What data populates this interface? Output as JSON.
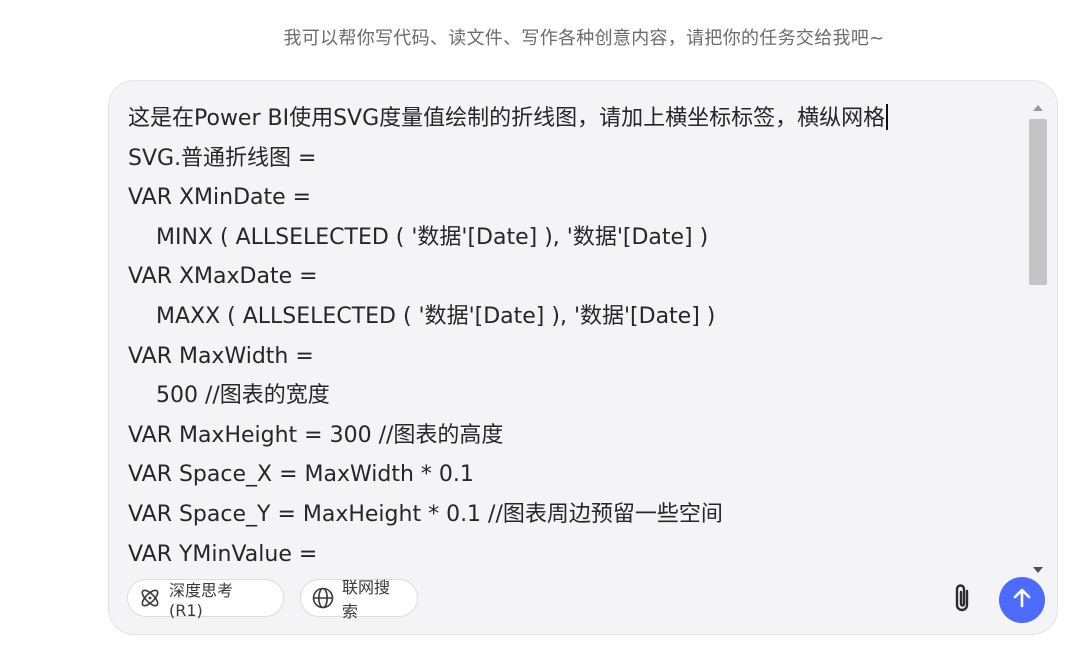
{
  "hint_text": "我可以帮你写代码、读文件、写作各种创意内容，请把你的任务交给我吧~",
  "composer": {
    "lines": [
      "这是在Power BI使用SVG度量值绘制的折线图，请加上横坐标标签，横纵网格",
      "SVG.普通折线图 =",
      "VAR XMinDate =",
      "MINX ( ALLSELECTED ( '数据'[Date] ), '数据'[Date] )",
      "VAR XMaxDate =",
      "MAXX ( ALLSELECTED ( '数据'[Date] ), '数据'[Date] )",
      "VAR MaxWidth =",
      "500 //图表的宽度",
      "VAR MaxHeight = 300 //图表的高度",
      "VAR Space_X = MaxWidth * 0.1",
      "VAR Space_Y = MaxHeight * 0.1 //图表周边预留一些空间",
      "VAR YMinValue ="
    ]
  },
  "toolbar": {
    "deepthink_label": "深度思考 (R1)",
    "search_label": "联网搜索",
    "deepthink_icon": "atom-icon",
    "search_icon": "globe-icon",
    "attach_icon": "paperclip-icon",
    "send_icon": "arrow-up-icon",
    "send_color": "#4d6bfe"
  }
}
